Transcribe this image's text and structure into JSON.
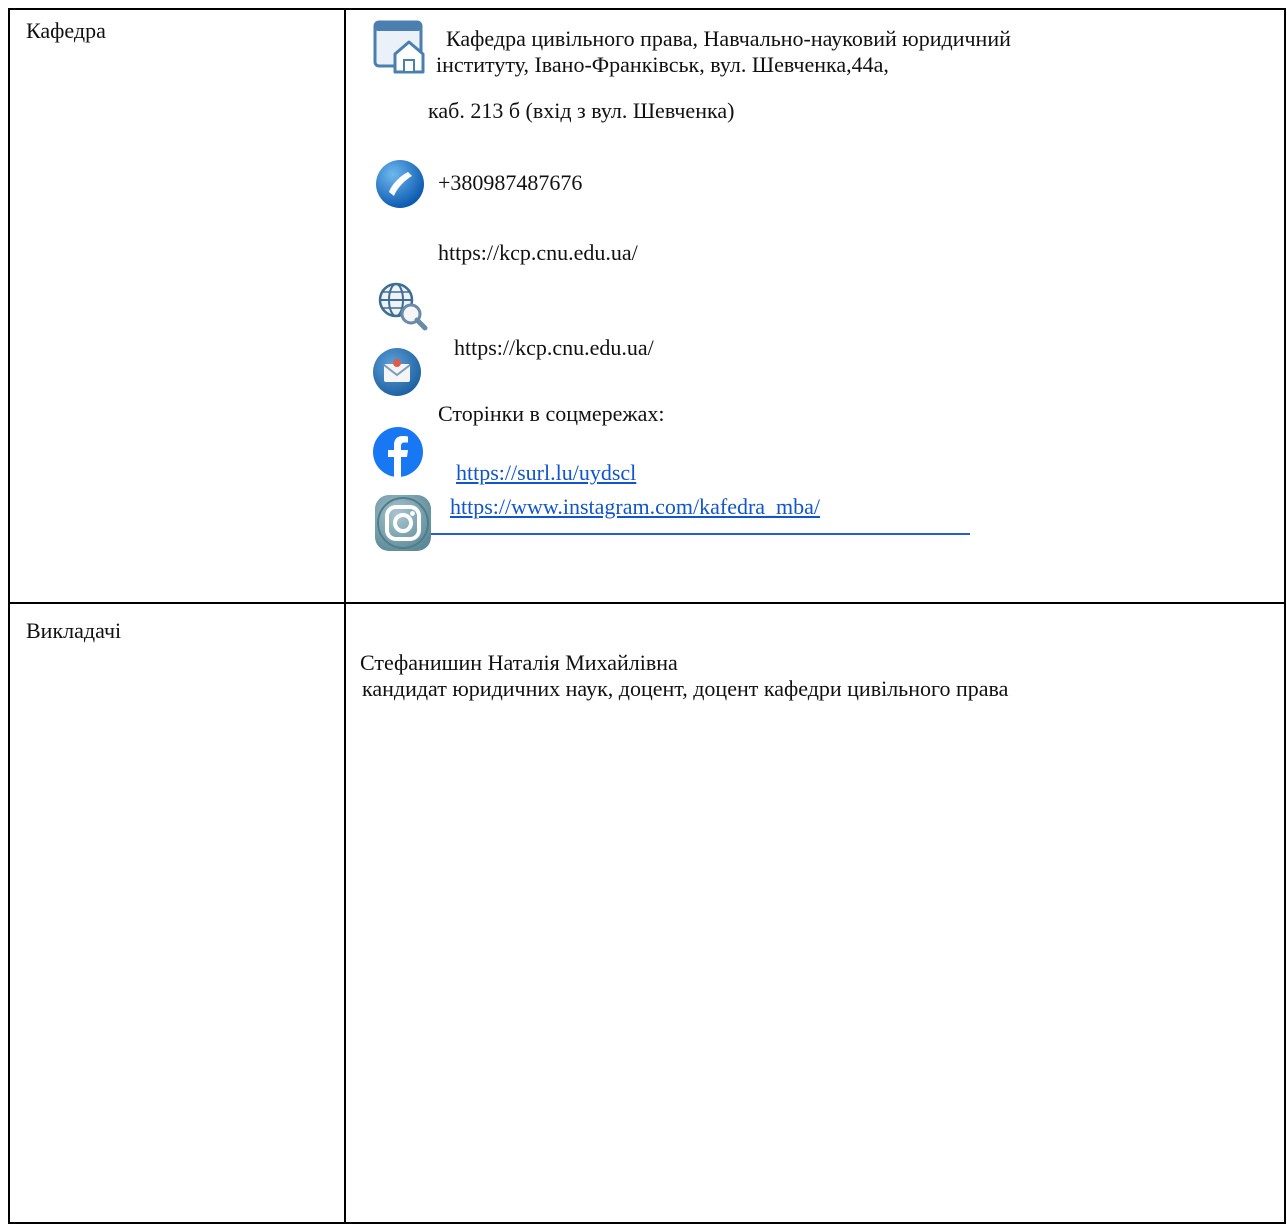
{
  "rows": {
    "department": {
      "label": "Кафедра",
      "address": {
        "line1": "Кафедра цивільного права, Навчально-науковий юридичний",
        "line2": "інституту,  Івано-Франківськ, вул. Шевченка,44а,",
        "line3": "каб. 213 б (вхід з вул. Шевченка)"
      },
      "phone": "+380987487676",
      "website": "https://kcp.cnu.edu.ua/",
      "email": "https://kcp.cnu.edu.ua/",
      "social_heading": "Сторінки в соцмережах:",
      "facebook_link": "https://surl.lu/uydscl",
      "instagram_link": "https://www.instagram.com/kafedra_mba/"
    },
    "teachers": {
      "label": "Викладачі",
      "name": "Стефанишин Наталія Михайлівна",
      "title": "кандидат юридичних наук, доцент, доцент кафедри цивільного права"
    }
  },
  "icons": {
    "address": "home-window-icon",
    "phone": "phone-icon",
    "website": "globe-search-icon",
    "email": "envelope-icon",
    "facebook": "facebook-icon",
    "instagram": "instagram-icon"
  },
  "colors": {
    "link": "#1155cc",
    "border": "#000000",
    "icon_blue": "#1e73c8"
  }
}
